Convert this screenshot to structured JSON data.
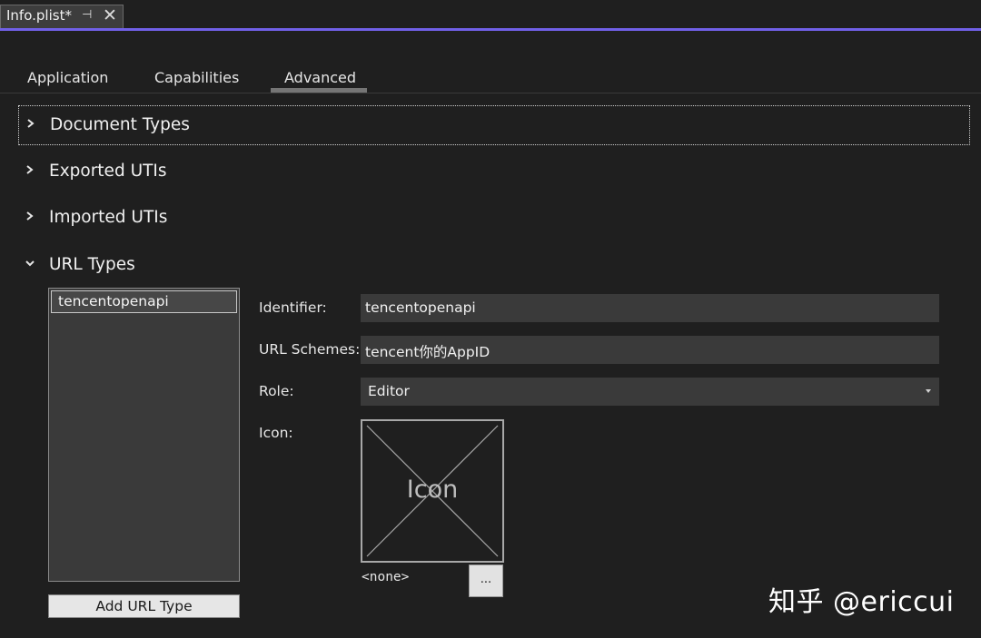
{
  "document_tab": {
    "title": "Info.plist*",
    "pin_glyph": "⊣",
    "close_glyph": "✕"
  },
  "editor_tabs": [
    {
      "label": "Application"
    },
    {
      "label": "Capabilities"
    },
    {
      "label": "Advanced",
      "selected": true
    }
  ],
  "sections": [
    {
      "label": "Document Types",
      "expanded": false,
      "focused": true
    },
    {
      "label": "Exported UTIs",
      "expanded": false
    },
    {
      "label": "Imported UTIs",
      "expanded": false
    },
    {
      "label": "URL Types",
      "expanded": true
    }
  ],
  "url_types": {
    "items": [
      {
        "label": "tencentopenapi",
        "selected": true
      }
    ],
    "add_button": "Add URL Type"
  },
  "form": {
    "identifier": {
      "label": "Identifier:",
      "value": "tencentopenapi"
    },
    "url_schemes": {
      "label": "URL Schemes:",
      "value": "tencent你的AppID"
    },
    "role": {
      "label": "Role:",
      "value": "Editor"
    },
    "icon": {
      "label": "Icon:",
      "placeholder_text": "Icon",
      "value": "<none>",
      "browse_label": "..."
    }
  },
  "watermark": "知乎 @ericcui",
  "colors": {
    "accent": "#7160e8",
    "background": "#1f1f1f",
    "field": "#3a3a3a"
  }
}
